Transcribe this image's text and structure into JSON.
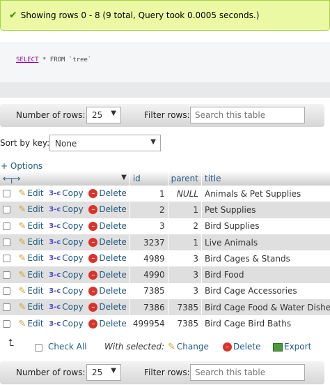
{
  "message": {
    "text": "Showing rows 0 - 8 (9 total, Query took 0.0005 seconds.)"
  },
  "sql": {
    "keyword": "SELECT",
    "rest": " * FROM ",
    "table": "`tree`"
  },
  "navigation": {
    "rows_label": "Number of rows:",
    "rows_value": "25",
    "filter_label": "Filter rows:",
    "filter_placeholder": "Search this table"
  },
  "sort": {
    "label": "Sort by key:",
    "value": "None"
  },
  "options_label": "+ Options",
  "table": {
    "columns": [
      "id",
      "parent",
      "title"
    ],
    "actions": {
      "edit": "Edit",
      "copy": "Copy",
      "delete": "Delete"
    },
    "rows": [
      {
        "id": "1",
        "parent": "NULL",
        "title": "Animals & Pet Supplies"
      },
      {
        "id": "2",
        "parent": "1",
        "title": "Pet Supplies"
      },
      {
        "id": "3",
        "parent": "2",
        "title": "Bird Supplies"
      },
      {
        "id": "3237",
        "parent": "1",
        "title": "Live Animals"
      },
      {
        "id": "4989",
        "parent": "3",
        "title": "Bird Cages & Stands"
      },
      {
        "id": "4990",
        "parent": "3",
        "title": "Bird Food"
      },
      {
        "id": "7385",
        "parent": "3",
        "title": "Bird Cage Accessories"
      },
      {
        "id": "7386",
        "parent": "7385",
        "title": "Bird Cage Food & Water Dishes"
      },
      {
        "id": "499954",
        "parent": "7385",
        "title": "Bird Cage Bird Baths"
      }
    ]
  },
  "bulk": {
    "check_all": "Check All",
    "with_selected": "With selected:",
    "change": "Change",
    "delete": "Delete",
    "export": "Export"
  },
  "colors": {
    "link": "#235a81",
    "success_bg": "#ebf8a4",
    "even_row": "#dfdfdf",
    "delete_icon": "#d8342c"
  }
}
